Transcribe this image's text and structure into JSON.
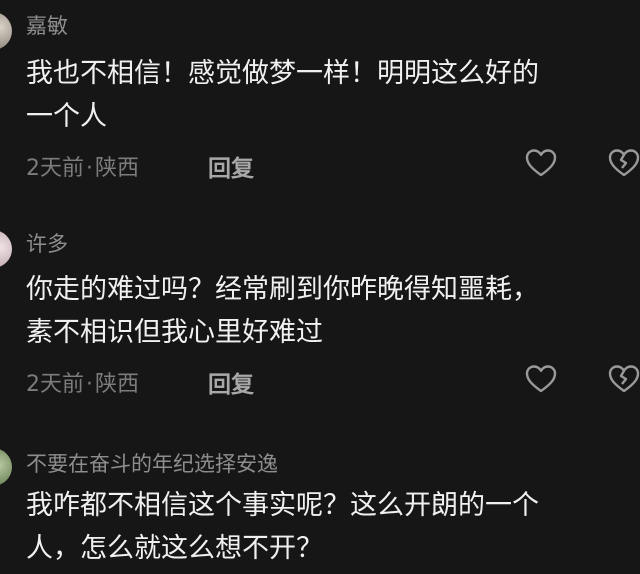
{
  "comments": [
    {
      "username": "嘉敏",
      "lines": [
        "我也不相信！感觉做梦一样！明明这么好的",
        "一个人"
      ],
      "time": "2天前",
      "separator": "·",
      "location": "陕西",
      "reply_label": "回复"
    },
    {
      "username": "许多",
      "lines": [
        "你走的难过吗？经常刷到你昨晚得知噩耗，",
        "素不相识但我心里好难过"
      ],
      "time": "2天前",
      "separator": "·",
      "location": "陕西",
      "reply_label": "回复"
    },
    {
      "username": "不要在奋斗的年纪选择安逸",
      "lines": [
        "我咋都不相信这个事实呢？这么开朗的一个",
        "人，怎么就这么想不开？"
      ]
    }
  ],
  "icons": {
    "like": "heart-outline-icon",
    "dislike": "broken-heart-icon"
  },
  "colors": {
    "background": "#161616",
    "primary_text": "#f0f0f0",
    "secondary_text": "#8d8d8d",
    "meta_text": "#7c7c7c"
  }
}
